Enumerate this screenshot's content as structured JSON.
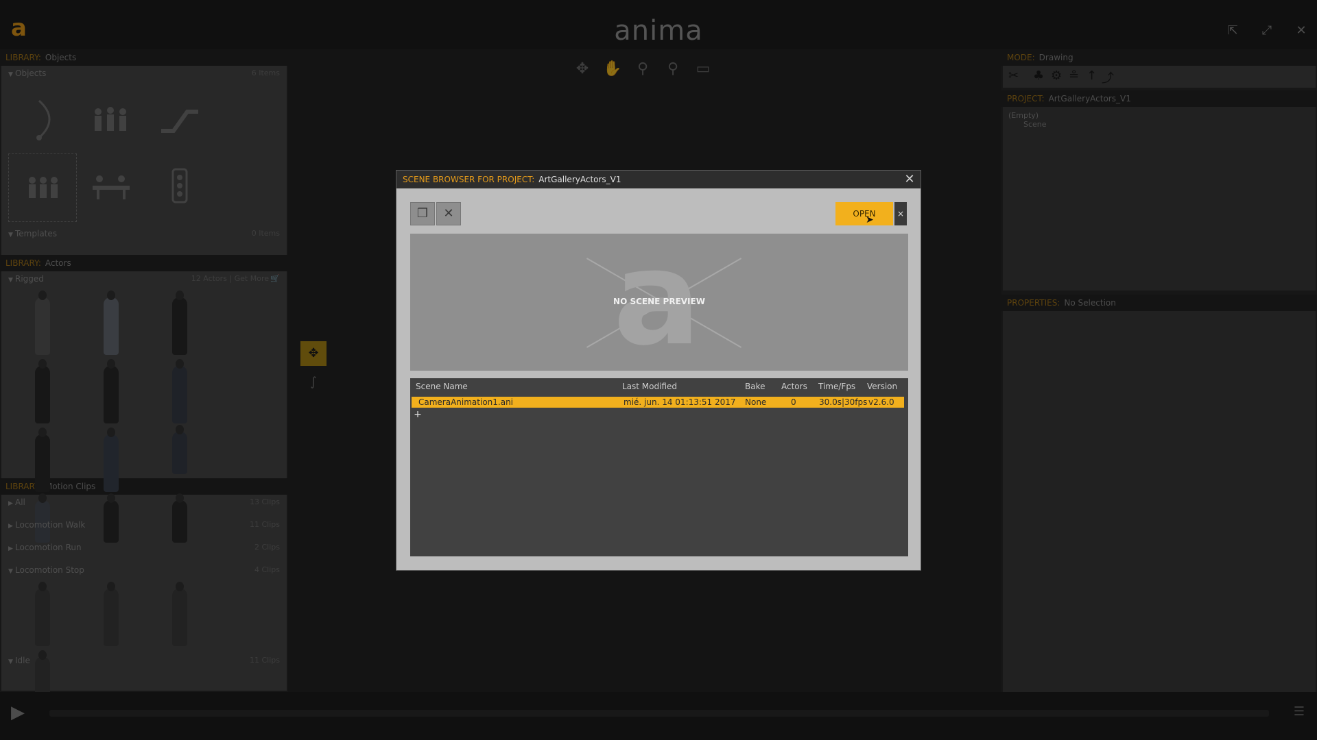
{
  "app": {
    "logo_letter": "a",
    "title": "anima",
    "window_buttons": {
      "popout": "⇱",
      "fullscreen": "⤢",
      "close": "✕"
    }
  },
  "left_panel": {
    "objects_library": {
      "key": "LIBRARY:",
      "value": "Objects",
      "sections": [
        {
          "label": "Objects",
          "count": "6 Items"
        },
        {
          "label": "Templates",
          "count": "0 Items"
        }
      ]
    },
    "actors_library": {
      "key": "LIBRARY:",
      "value": "Actors",
      "section_label": "Rigged",
      "section_meta": "12 Actors | Get More"
    },
    "motion_clips_library": {
      "key": "LIBRARY:",
      "value": "Motion Clips",
      "sections": [
        {
          "label": "All",
          "count": "13 Clips"
        },
        {
          "label": "Locomotion Walk",
          "count": "11 Clips"
        },
        {
          "label": "Locomotion Run",
          "count": "2 Clips"
        },
        {
          "label": "Locomotion Stop",
          "count": "4 Clips"
        },
        {
          "label": "Idle",
          "count": "11 Clips"
        }
      ]
    }
  },
  "right_panel": {
    "mode": {
      "key": "MODE:",
      "value": "Drawing"
    },
    "project": {
      "key": "PROJECT:",
      "value": "ArtGalleryActors_V1",
      "tree_root": "(Empty)",
      "tree_child": "Scene"
    },
    "properties": {
      "key": "PROPERTIES:",
      "value": "No Selection"
    }
  },
  "dialog": {
    "title_key": "SCENE BROWSER FOR PROJECT:",
    "title_value": "ArtGalleryActors_V1",
    "open_label": "OPEN",
    "open_close": "×",
    "preview_text": "NO SCENE PREVIEW",
    "columns": [
      "Scene Name",
      "Last Modified",
      "Bake",
      "Actors",
      "Time/Fps",
      "Version"
    ],
    "rows": [
      {
        "name": "CameraAnimation1.ani",
        "modified": "mié. jun. 14 01:13:51 2017",
        "bake": "None",
        "actors": "0",
        "timefps": "30.0s|30fps",
        "version": "v2.6.0"
      }
    ],
    "add_label": "+"
  },
  "colors": {
    "accent": "#f2b01d",
    "label_key": "#a8781a",
    "background": "#121212"
  }
}
